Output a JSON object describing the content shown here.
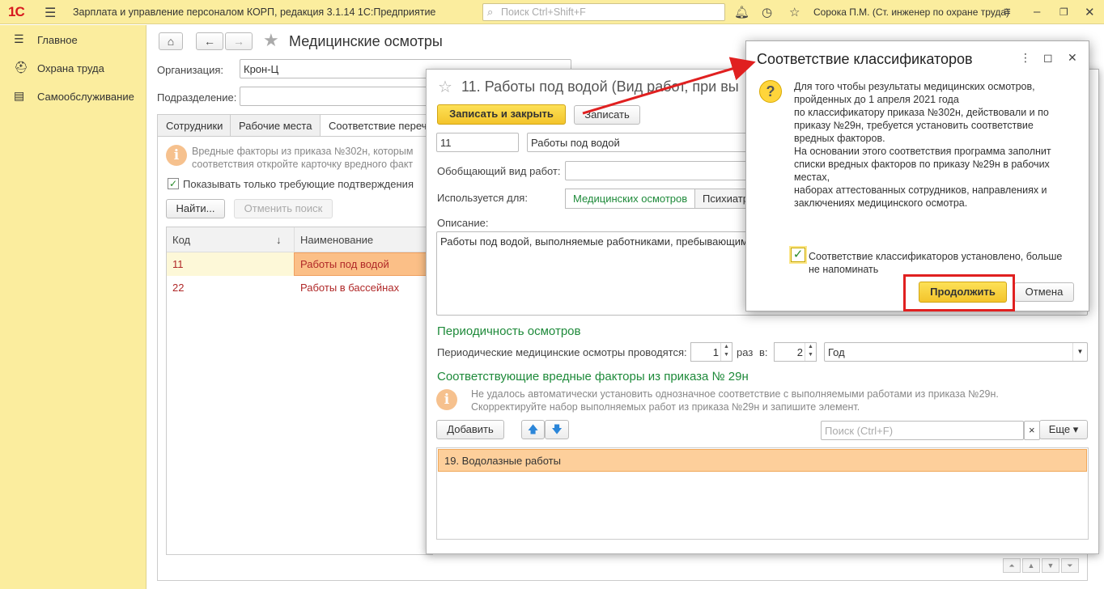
{
  "titlebar": {
    "logo": "1С",
    "app_title": "Зарплата и управление персоналом КОРП, редакция 3.1.14 1С:Предприятие",
    "search_placeholder": "Поиск Ctrl+Shift+F",
    "user": "Сорока П.М. (Ст. инженер по охране труда)",
    "icons": [
      "menu-icon",
      "search-icon",
      "bell-icon",
      "history-icon",
      "star-icon",
      "settings-icon",
      "minimize-icon",
      "restore-icon",
      "close-icon"
    ]
  },
  "sidebar": {
    "items": [
      {
        "label": "Главное",
        "icon": "menu-lines-icon"
      },
      {
        "label": "Охрана труда",
        "icon": "helmet-icon"
      },
      {
        "label": "Самообслуживание",
        "icon": "id-card-icon"
      }
    ]
  },
  "main": {
    "title": "Медицинские осмотры",
    "org_label": "Организация:",
    "org_value": "Крон-Ц",
    "dept_label": "Подразделение:",
    "tabs": [
      "Сотрудники",
      "Рабочие места",
      "Соответствие переч"
    ],
    "info_text_1": "Вредные факторы из приказа №302н, которым",
    "info_text_2": "соответствия откройте карточку вредного факт",
    "show_only_label": "Показывать только требующие подтверждения",
    "find_button": "Найти...",
    "cancel_search_button": "Отменить поиск",
    "grid_headers": {
      "code": "Код",
      "sort_arrow": "↓",
      "name": "Наименование"
    },
    "rows": [
      {
        "code": "11",
        "name": "Работы под водой"
      },
      {
        "code": "22",
        "name": "Работы в бассейнах"
      }
    ]
  },
  "element_dialog": {
    "title": "11. Работы под водой (Вид работ, при вы",
    "save_close_button": "Записать и закрыть",
    "save_button": "Записать",
    "code_value": "11",
    "name_value": "Работы под водой",
    "generalizing_label": "Обобщающий вид работ:",
    "used_for_label": "Используется для:",
    "used_for_options": [
      "Медицинских осмотров",
      "Психиатр"
    ],
    "description_label": "Описание:",
    "description_value": "Работы под водой, выполняемые работниками, пребывающим",
    "periodicity_title": "Периодичность осмотров",
    "periodic_label": "Периодические медицинские осмотры проводятся:",
    "times_value": "1",
    "times_label": "раз",
    "in_label": "в:",
    "period_value": "2",
    "period_unit": "Год",
    "factors_title": "Соответствующие вредные факторы из приказа № 29н",
    "factors_info_1": "Не удалось автоматически установить однозначное соответствие с выполняемыми работами из приказа №29н.",
    "factors_info_2": "Скорректируйте набор выполняемых работ из приказа №29н и запишите элемент.",
    "add_button": "Добавить",
    "search_placeholder": "Поиск (Ctrl+F)",
    "more_button": "Еще",
    "factor_rows": [
      "19. Водолазные работы"
    ]
  },
  "classifier_dialog": {
    "title": "Соответствие классификаторов",
    "text_lines": [
      "Для того чтобы результаты медицинских осмотров,",
      "пройденных до 1 апреля 2021 года",
      "по классификатору приказа №302н, действовали и по",
      "приказу №29н, требуется установить соответствие",
      "вредных факторов.",
      "На основании этого соответствия программа заполнит",
      "списки вредных факторов по приказу №29н в рабочих",
      "местах,",
      "наборах аттестованных сотрудников, направлениях и",
      "заключениях медицинского осмотра."
    ],
    "checkbox_label": "Соответствие классификаторов установлено, больше не напоминать",
    "checkbox_checked": true,
    "continue_button": "Продолжить",
    "cancel_button": "Отмена"
  },
  "colors": {
    "accent_yellow": "#fbed9e",
    "primary_button": "#f3c42b",
    "highlight_frame": "#e02020",
    "section_green": "#1e8a3a",
    "link_red": "#b02828",
    "selected_row": "#fdcf9b"
  }
}
